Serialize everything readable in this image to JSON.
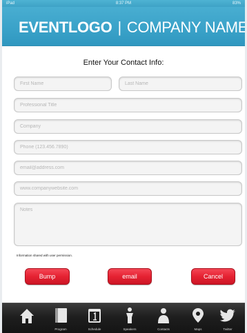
{
  "status_bar": {
    "carrier": "iPad",
    "time": "8:37 PM",
    "battery": "83%"
  },
  "header": {
    "logo": "EVENTLOGO",
    "separator": "|",
    "company": "COMPANY NAME"
  },
  "form": {
    "heading": "Enter Your Contact Info:",
    "first_name_placeholder": "First Name",
    "last_name_placeholder": "Last Name",
    "title_placeholder": "Professional Title",
    "company_placeholder": "Company",
    "phone_placeholder": "Phone (123.456.7890)",
    "email_placeholder": "email@address.com",
    "website_placeholder": "www.companywebsite.com",
    "notes_placeholder": "Notes",
    "permission_note": "Information shared with user permission."
  },
  "buttons": {
    "bump": "Bump",
    "email": "email",
    "cancel": "Cancel"
  },
  "tabs": [
    {
      "icon": "home-icon",
      "label": ""
    },
    {
      "icon": "book-icon",
      "label": "Program"
    },
    {
      "icon": "calendar-icon",
      "label": "Schedule"
    },
    {
      "icon": "speaker-icon",
      "label": "Speakers"
    },
    {
      "icon": "person-icon",
      "label": "Contacts"
    },
    {
      "icon": "map-pin-icon",
      "label": "Maps"
    },
    {
      "icon": "twitter-bird-icon",
      "label": "Twitter"
    }
  ],
  "colors": {
    "header": "#39a1c8",
    "button_red": "#e52232",
    "tab_bar": "#1e1e1e"
  }
}
